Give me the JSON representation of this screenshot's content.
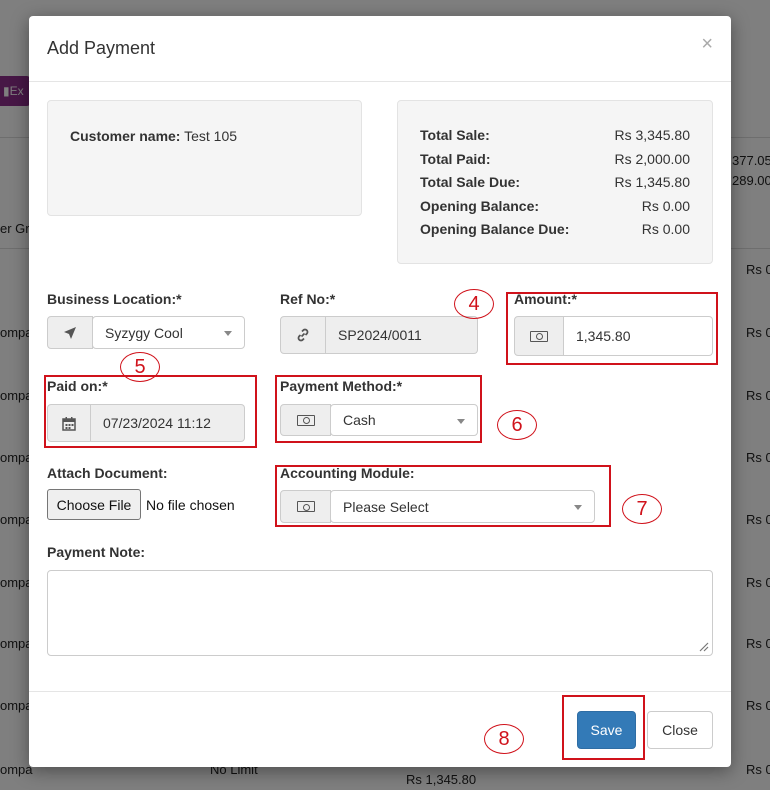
{
  "background": {
    "export_button": "Ex",
    "col_header": "er Gr",
    "amount_a": "377.05",
    "amount_b": "289.00",
    "row_prefix": "Rs 0.",
    "row_label": "ompa",
    "bottom_cell": "No Limit",
    "bottom_total": "Rs 1,345.80"
  },
  "modal": {
    "title": "Add Payment",
    "close_symbol": "×"
  },
  "customer": {
    "label": "Customer name:",
    "value": "Test 105"
  },
  "totals": [
    {
      "label": "Total Sale:",
      "value": "Rs 3,345.80"
    },
    {
      "label": "Total Paid:",
      "value": "Rs 2,000.00"
    },
    {
      "label": "Total Sale Due:",
      "value": "Rs 1,345.80"
    },
    {
      "label": "Opening Balance:",
      "value": "Rs 0.00"
    },
    {
      "label": "Opening Balance Due:",
      "value": "Rs 0.00"
    }
  ],
  "form": {
    "business_location": {
      "label": "Business Location:*",
      "value": "Syzygy Cool",
      "icon": "location-arrow-icon"
    },
    "ref_no": {
      "label": "Ref No:*",
      "value": "SP2024/0011",
      "icon": "link-icon"
    },
    "amount": {
      "label": "Amount:*",
      "value": "1,345.80",
      "icon": "money-icon"
    },
    "paid_on": {
      "label": "Paid on:*",
      "value": "07/23/2024 11:12",
      "icon": "calendar-icon"
    },
    "payment_method": {
      "label": "Payment Method:*",
      "value": "Cash",
      "icon": "money-icon"
    },
    "attach_document": {
      "label": "Attach Document:",
      "button": "Choose File",
      "status": "No file chosen"
    },
    "accounting_module": {
      "label": "Accounting Module:",
      "value": "Please Select",
      "icon": "money-icon"
    },
    "payment_note": {
      "label": "Payment Note:",
      "value": ""
    }
  },
  "buttons": {
    "save": "Save",
    "close": "Close"
  },
  "annotations": {
    "n4": "4",
    "n5": "5",
    "n6": "6",
    "n7": "7",
    "n8": "8",
    "color": "#d0121b"
  }
}
